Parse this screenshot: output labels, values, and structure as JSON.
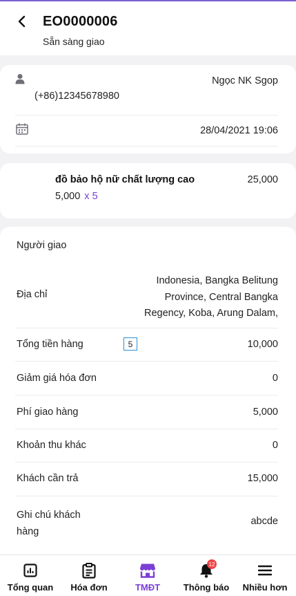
{
  "header": {
    "order_code": "EO0000006",
    "status": "Sẵn sàng giao"
  },
  "customer": {
    "name": "Ngọc NK Sgop",
    "phone": "(+86)12345678980",
    "date": "28/04/2021 19:06"
  },
  "product": {
    "name": "đồ bảo hộ nữ chất lượng cao",
    "total": "25,000",
    "unit_price": "5,000",
    "quantity": "x 5"
  },
  "details": {
    "shipper_label": "Người giao",
    "address_label": "Địa chỉ",
    "address_lines": [
      "Indonesia, Bangka Belitung",
      "Province, Central Bangka",
      "Regency, Koba, Arung Dalam,"
    ],
    "subtotal_label": "Tổng tiền hàng",
    "subtotal_qty": "5",
    "subtotal_value": "10,000",
    "discount_label": "Giảm giá hóa đơn",
    "discount_value": "0",
    "shipping_label": "Phí giao hàng",
    "shipping_value": "5,000",
    "other_label": "Khoản thu khác",
    "other_value": "0",
    "due_label": "Khách cần trả",
    "due_value": "15,000",
    "note_label_lines": [
      "Ghi chú khách",
      "hàng"
    ],
    "note_value": "abcde"
  },
  "bottom_nav": {
    "items": [
      {
        "label": "Tổng quan",
        "icon": "dashboard-icon"
      },
      {
        "label": "Hóa đơn",
        "icon": "invoice-icon"
      },
      {
        "label": "TMĐT",
        "icon": "store-icon"
      },
      {
        "label": "Thông báo",
        "icon": "bell-icon"
      },
      {
        "label": "Nhiều hơn",
        "icon": "menu-icon"
      }
    ],
    "active_index": 2,
    "notification_count": "12"
  },
  "colors": {
    "accent": "#7b3fd6",
    "badge": "#f04545",
    "qty_border": "#2f8fd0",
    "background": "#f2f2f4"
  }
}
